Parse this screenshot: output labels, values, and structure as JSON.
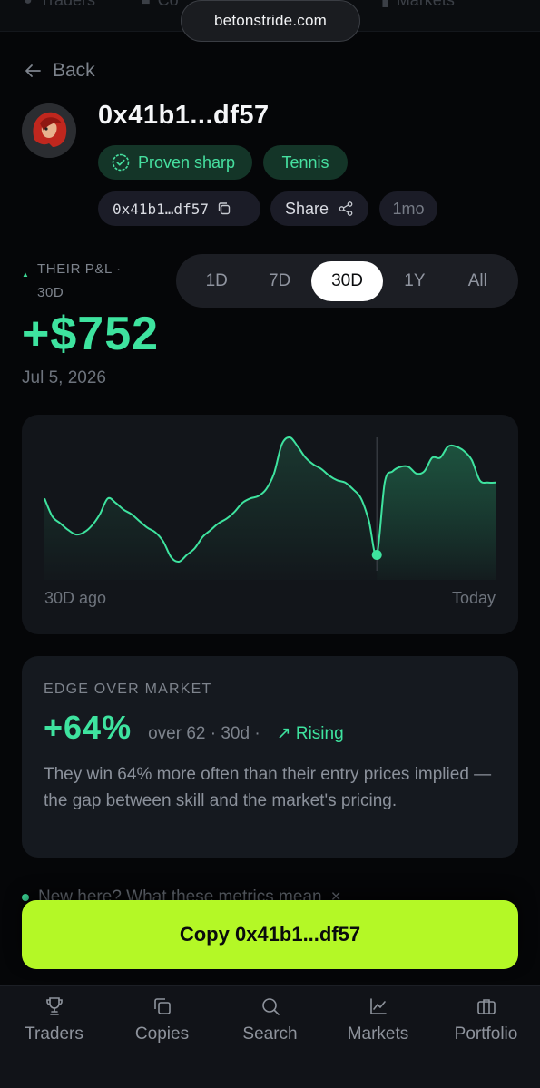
{
  "browser": {
    "url": "betonstride.com",
    "tabs": [
      "Traders",
      "Co",
      "Markets"
    ]
  },
  "header": {
    "back_label": "Back",
    "trader_name": "0x41b1...df57",
    "badges": [
      "Proven sharp",
      "Tennis"
    ],
    "address": "0x41b1…df57",
    "share_label": "Share",
    "tenure": "1mo"
  },
  "pnl": {
    "label": "THEIR P&L · 30D",
    "value": "+$752",
    "date": "Jul 5, 2026",
    "ranges": [
      "1D",
      "7D",
      "30D",
      "1Y",
      "All"
    ],
    "active_range": "30D"
  },
  "chart_data": {
    "type": "area",
    "x_start_label": "30D ago",
    "x_end_label": "Today",
    "values": [
      548,
      540,
      537,
      534,
      532,
      533,
      536,
      541,
      548,
      546,
      543,
      541,
      538,
      535,
      533,
      529,
      522,
      520,
      523,
      526,
      531,
      534,
      537,
      539,
      542,
      546,
      548,
      549,
      552,
      559,
      572,
      575,
      571,
      566,
      563,
      561,
      558,
      556,
      555,
      552,
      548,
      538,
      523,
      555,
      560,
      562,
      562,
      559,
      560,
      566,
      566,
      571,
      571,
      569,
      565,
      556,
      555,
      555
    ],
    "marker_index": 42,
    "color": "#3ee39f"
  },
  "edge": {
    "title": "EDGE OVER MARKET",
    "value": "+64%",
    "meta": "over 62 · 30d ·",
    "trend": "Rising",
    "description": "They win 64% more often than their entry prices implied — the gap between skill and the market's pricing."
  },
  "hint": {
    "text": "New here? What these metrics mean"
  },
  "cta": {
    "label": "Copy 0x41b1...df57",
    "color": "#b4f826"
  },
  "nav": {
    "items": [
      {
        "label": "Traders",
        "icon": "trophy-icon"
      },
      {
        "label": "Copies",
        "icon": "copies-icon"
      },
      {
        "label": "Search",
        "icon": "search-icon"
      },
      {
        "label": "Markets",
        "icon": "markets-icon"
      },
      {
        "label": "Portfolio",
        "icon": "portfolio-icon"
      }
    ]
  }
}
